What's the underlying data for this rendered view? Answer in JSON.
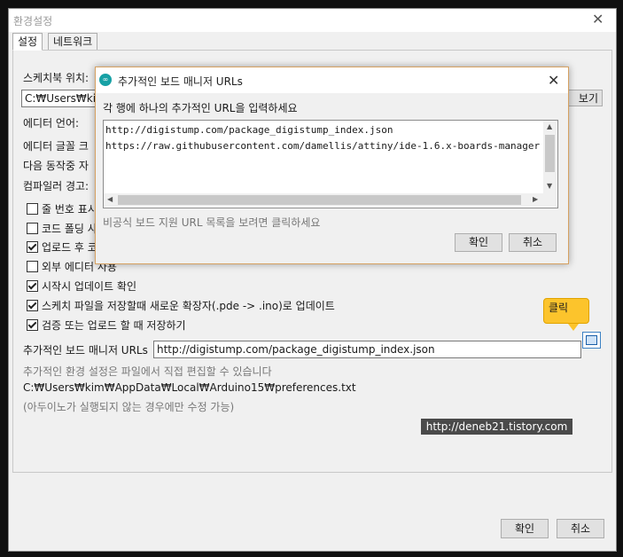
{
  "main_window": {
    "title": "환경설정",
    "close_glyph": "✕",
    "tabs": [
      "설정",
      "네트워크"
    ],
    "sketchbook_label": "스케치북 위치:",
    "sketchbook_value": "C:₩Users₩kim",
    "browse_label": "보기",
    "editor_language_label": "에디터 언어:",
    "editor_font_label": "에디터 글꼴 크",
    "verbose_label": "다음 동작중 자",
    "compiler_warnings_label": "컴파일러 경고:",
    "checkboxes": [
      {
        "label": "줄 번호 표시",
        "checked": false
      },
      {
        "label": "코드 폴딩 사",
        "checked": false
      },
      {
        "label": "업로드 후 코",
        "checked": true
      },
      {
        "label": "외부 에디터 사용",
        "checked": false
      },
      {
        "label": "시작시 업데이트 확인",
        "checked": true
      },
      {
        "label": "스케치 파일을 저장할때 새로운 확장자(.pde -> .ino)로 업데이트",
        "checked": true
      },
      {
        "label": "검증 또는 업로드 할 때 저장하기",
        "checked": true
      }
    ],
    "board_urls_label": "추가적인 보드 매니저 URLs",
    "board_urls_value": "http://digistump.com/package_digistump_index.json",
    "hint_more_prefs": "추가적인 환경 설정은 파일에서 직접 편집할 수 있습니다",
    "prefs_path": "C:₩Users₩kim₩AppData₩Local₩Arduino15₩preferences.txt",
    "hint_edit_only": "(아두이노가 실행되지 않는 경우에만 수정 가능)",
    "ok_label": "확인",
    "cancel_label": "취소"
  },
  "dialog": {
    "title": "추가적인 보드 매니저 URLs",
    "logo_text": "∞",
    "close_glyph": "✕",
    "instruction": "각 행에 하나의 추가적인 URL을 입력하세요",
    "urls": [
      "http://digistump.com/package_digistump_index.json",
      "https://raw.githubusercontent.com/damellis/attiny/ide-1.6.x-boards-manager"
    ],
    "unofficial_link": "비공식 보드 지원 URL 목록을 보려면 클릭하세요",
    "ok_label": "확인",
    "cancel_label": "취소"
  },
  "callout": {
    "text": "클릭",
    "color": "#fcc42c"
  },
  "watermark": "http://deneb21.tistory.com",
  "colors": {
    "dialog_border": "#d6a161",
    "logo": "#17a1a5",
    "watermark_bg": "#4a4a4a"
  }
}
